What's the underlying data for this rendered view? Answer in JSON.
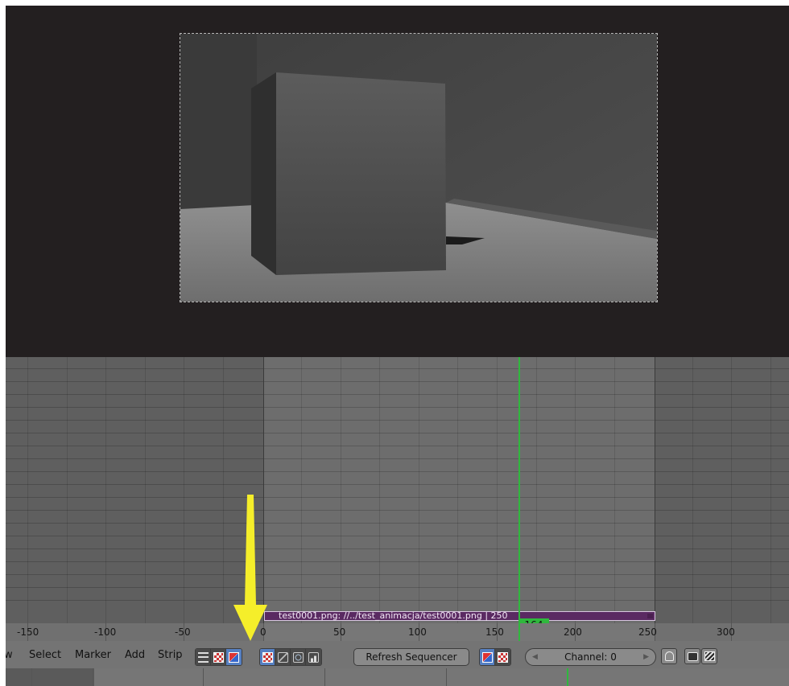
{
  "timeline": {
    "current_frame": "164",
    "strip_label": "test0001.png: //../test_animacja/test0001.png | 250",
    "ruler_labels": [
      "-150",
      "-100",
      "-50",
      "0",
      "50",
      "100",
      "150",
      "200",
      "250",
      "300"
    ]
  },
  "header": {
    "menu": [
      "w",
      "Select",
      "Marker",
      "Add",
      "Strip"
    ],
    "refresh_label": "Refresh Sequencer",
    "channel_label": "Channel: 0"
  },
  "annotation": {
    "arrow_color": "#f5ee2a"
  },
  "colors": {
    "playhead": "#2fb83d",
    "strip": "#5a2a62",
    "active_button": "#5680c2"
  }
}
